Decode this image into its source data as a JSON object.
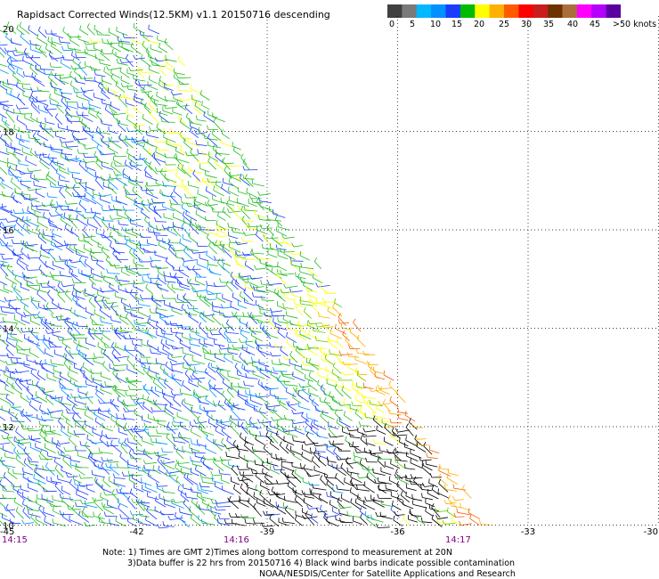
{
  "title": "Rapidsact Corrected Winds(12.5KM) v1.1 20150716 descending",
  "colorbar": {
    "units_label": ">50 knots",
    "tick_labels": [
      "0",
      "5",
      "10",
      "15",
      "20",
      "25",
      "30",
      "35",
      "40",
      "45"
    ],
    "colors": [
      "#404040",
      "#7a7a7a",
      "#00b8ff",
      "#0090ff",
      "#1a3cff",
      "#00bb00",
      "#ffff00",
      "#ffb000",
      "#ff5a00",
      "#ff0000",
      "#c81e1e",
      "#6e3200",
      "#aa6e3c",
      "#ff00ff",
      "#b400ff",
      "#5a00a0"
    ]
  },
  "map": {
    "lon_labels": [
      "-45",
      "-42",
      "-39",
      "-36",
      "-33",
      "-30"
    ],
    "lat_labels": [
      "20",
      "18",
      "16",
      "14",
      "12",
      "10"
    ],
    "time_labels": [
      "14:15",
      "14:16",
      "14:17"
    ],
    "colors": {
      "grid": "#000000",
      "time_label": "#800080",
      "black_barb": "#000000"
    }
  },
  "notes": {
    "line1": "Note: 1) Times are GMT 2)Times along bottom correspond to measurement at 20N",
    "line2": "3)Data buffer is 22 hrs from 20150716 4) Black wind barbs indicate possible contamination",
    "line3": "NOAA/NESDIS/Center for Satellite Applications and Research"
  }
}
